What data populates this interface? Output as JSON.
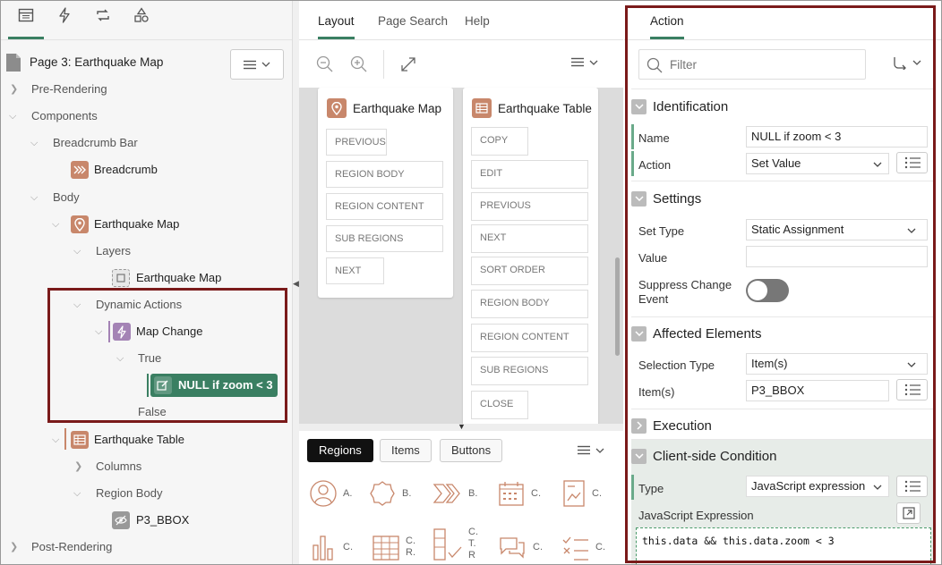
{
  "left": {
    "tabs": [
      {
        "icon": "rendering-tree-icon"
      },
      {
        "icon": "lightning-icon"
      },
      {
        "icon": "process-cycle-icon"
      },
      {
        "icon": "shared-components-icon"
      }
    ],
    "page_title": "Page 3: Earthquake Map",
    "tree": {
      "pre_rendering": "Pre-Rendering",
      "components": "Components",
      "breadcrumb_bar": "Breadcrumb Bar",
      "breadcrumb": "Breadcrumb",
      "body": "Body",
      "earthquake_map": "Earthquake Map",
      "layers": "Layers",
      "earthquake_map_layer": "Earthquake Map",
      "dynamic_actions": "Dynamic Actions",
      "map_change": "Map Change",
      "true": "True",
      "null_zoom": "NULL if zoom < 3",
      "false": "False",
      "earthquake_table": "Earthquake Table",
      "columns": "Columns",
      "region_body": "Region Body",
      "p3_bbox": "P3_BBOX",
      "post_rendering": "Post-Rendering"
    }
  },
  "middle": {
    "tabs": [
      "Layout",
      "Page Search",
      "Help"
    ],
    "card1": {
      "title": "Earthquake Map",
      "slots": [
        "PREVIOUS",
        "REGION BODY",
        "REGION CONTENT",
        "SUB REGIONS",
        "NEXT"
      ]
    },
    "card2": {
      "title": "Earthquake Table",
      "slots": [
        "COPY",
        "EDIT",
        "PREVIOUS",
        "NEXT",
        "SORT ORDER",
        "REGION BODY",
        "REGION CONTENT",
        "SUB REGIONS",
        "CLOSE"
      ]
    },
    "gallery_tabs": [
      "Regions",
      "Items",
      "Buttons"
    ],
    "gallery_row1": [
      "A.",
      "B.",
      "B.",
      "C.",
      "C."
    ],
    "gallery_row2": [
      "C.",
      "C.",
      "C.",
      "C.",
      "C."
    ],
    "gallery_row2b": [
      "",
      "R.",
      "T.",
      "",
      ""
    ],
    "gallery_row2c": [
      "",
      "",
      "R",
      "",
      ""
    ]
  },
  "right": {
    "tab": "Action",
    "filter_placeholder": "Filter",
    "sections": {
      "identification": "Identification",
      "settings": "Settings",
      "affected": "Affected Elements",
      "execution": "Execution",
      "client_condition": "Client-side Condition"
    },
    "fields": {
      "name_label": "Name",
      "name_value": "NULL if zoom < 3",
      "action_label": "Action",
      "action_value": "Set Value",
      "set_type_label": "Set Type",
      "set_type_value": "Static Assignment",
      "value_label": "Value",
      "value_value": "",
      "suppress_label1": "Suppress Change",
      "suppress_label2": "Event",
      "selection_type_label": "Selection Type",
      "selection_type_value": "Item(s)",
      "items_label": "Item(s)",
      "items_value": "P3_BBOX",
      "type_label": "Type",
      "type_value": "JavaScript expression",
      "js_label": "JavaScript Expression",
      "js_code": "this.data && this.data.zoom < 3"
    }
  },
  "colors": {
    "accent": "#3a7f62",
    "highlight_border": "#7a1a1a",
    "region_icon": "#c8876b",
    "dynamic_action_icon": "#a483b5",
    "action_selected": "#3a7f62"
  }
}
